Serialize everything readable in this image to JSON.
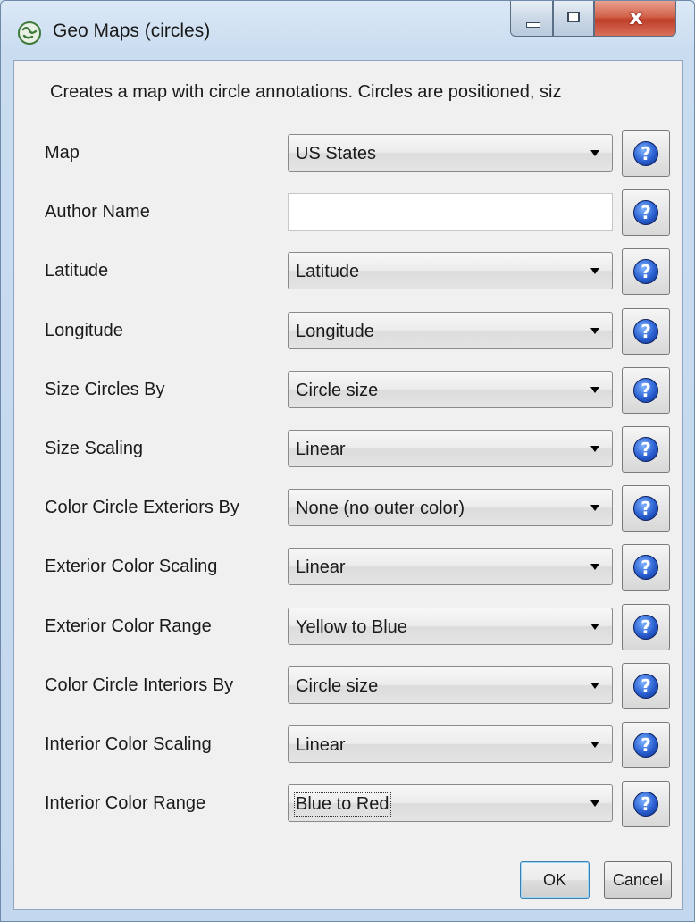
{
  "window": {
    "title": "Geo Maps (circles)",
    "icon": "geo-maps-app-icon",
    "controls": {
      "minimize": "minimize-icon",
      "maximize": "maximize-icon",
      "close": "x"
    }
  },
  "description": "Creates a map with circle annotations.  Circles are positioned, siz",
  "fields": [
    {
      "label": "Map",
      "type": "select",
      "value": "US States"
    },
    {
      "label": "Author Name",
      "type": "text",
      "value": ""
    },
    {
      "label": "Latitude",
      "type": "select",
      "value": "Latitude"
    },
    {
      "label": "Longitude",
      "type": "select",
      "value": "Longitude"
    },
    {
      "label": "Size Circles By",
      "type": "select",
      "value": "Circle size"
    },
    {
      "label": "Size Scaling",
      "type": "select",
      "value": "Linear"
    },
    {
      "label": "Color Circle Exteriors By",
      "type": "select",
      "value": "None (no outer color)"
    },
    {
      "label": "Exterior Color Scaling",
      "type": "select",
      "value": "Linear"
    },
    {
      "label": "Exterior Color Range",
      "type": "select",
      "value": "Yellow to Blue"
    },
    {
      "label": "Color Circle Interiors By",
      "type": "select",
      "value": "Circle size"
    },
    {
      "label": "Interior Color Scaling",
      "type": "select",
      "value": "Linear"
    },
    {
      "label": "Interior Color Range",
      "type": "select",
      "value": "Blue to Red",
      "focused": true
    }
  ],
  "help_glyph": "?",
  "buttons": {
    "ok": "OK",
    "cancel": "Cancel"
  }
}
